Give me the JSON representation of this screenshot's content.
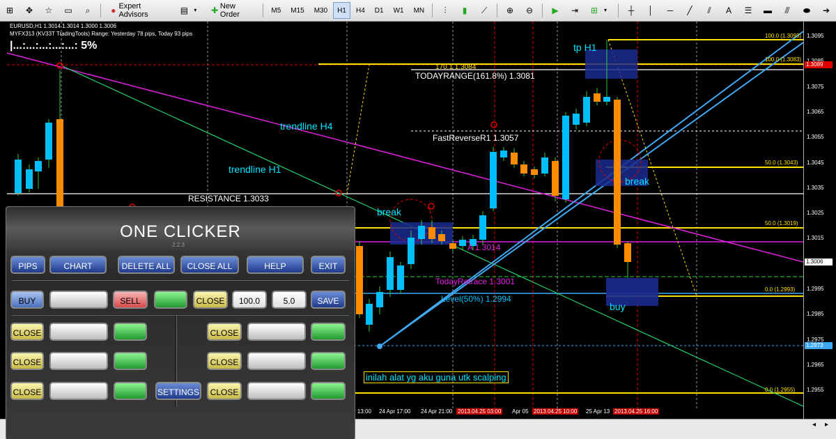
{
  "toolbar": {
    "expert_advisors": "Expert Advisors",
    "new_order": "New Order",
    "timeframes": [
      "M5",
      "M15",
      "M30",
      "H1",
      "H4",
      "D1",
      "W1",
      "MN"
    ],
    "active_timeframe": "H1"
  },
  "chart": {
    "header_line1": "EURUSD,H1  1.3014 1.3014 1.3000 1.3006",
    "header_line2": "MYFX313 (KV33T TradingTools)  Range: Yesterday 78 pips, Today 93 pips",
    "strength": "|...:...:...:...:...:  5%",
    "labels": {
      "tp_h1": "tp H1",
      "todayrange": "TODAYRANGE(161.8%) 1.3081",
      "level_1708": "170.1 1.3084",
      "trendline_h4": "trendline H4",
      "trendline_h1": "trendline H1",
      "fastreverse": "FastReverseR1 1.3057",
      "resistance": "RESISTANCE 1.3033",
      "break_left": "break",
      "break_right": "break",
      "level_pivot": "A 1.3014",
      "todayretrace": "TodayRetrace 1.3001",
      "level50": "Level(50%) 1.2994",
      "buy": "buy",
      "note": "inilah alat yg aku guna utk scalping"
    },
    "fib_labels": [
      "100.0 (1.3093)",
      "100.0 (1.3083)",
      "50.0 (1.3043)",
      "50.0 (1.3019)",
      "0.0 (1.2993)",
      "0.0 (1.2955)"
    ],
    "price_ticks": [
      "1.3095",
      "1.3085",
      "1.3075",
      "1.3065",
      "1.3055",
      "1.3045",
      "1.3035",
      "1.3025",
      "1.3015",
      "1.3005",
      "1.2995",
      "1.2985",
      "1.2975",
      "1.2965",
      "1.2955"
    ],
    "price_tags": {
      "red": "1.3089",
      "current": "1.3006",
      "blue": "1.2973"
    },
    "time_labels": [
      "r 13:00",
      "24 Apr 17:00",
      "24 Apr 21:00",
      "2013.04.25 03:00",
      "Apr 05",
      "2013.04.25 10:00",
      "25 Apr 13",
      "2013.04.25 16:00"
    ],
    "time_red": [
      false,
      false,
      false,
      true,
      false,
      true,
      false,
      true
    ]
  },
  "one_clicker": {
    "title": "ONE CLICKER",
    "version": "2.2.3",
    "row1": [
      "PIPS",
      "CHART",
      "DELETE ALL",
      "CLOSE ALL",
      "HELP",
      "EXIT"
    ],
    "buy": "BUY",
    "sell": "SELL",
    "close": "CLOSE",
    "lot": "100.0",
    "pips": "5.0",
    "save": "SAVE",
    "settings": "SETTINGS"
  },
  "colors": {
    "bull": "#00bfff",
    "bear": "#ff8c00",
    "fib": "#ffe000",
    "magenta": "#e020e0",
    "green_line": "#1fd16a",
    "blue_line": "#3fa9f5"
  }
}
